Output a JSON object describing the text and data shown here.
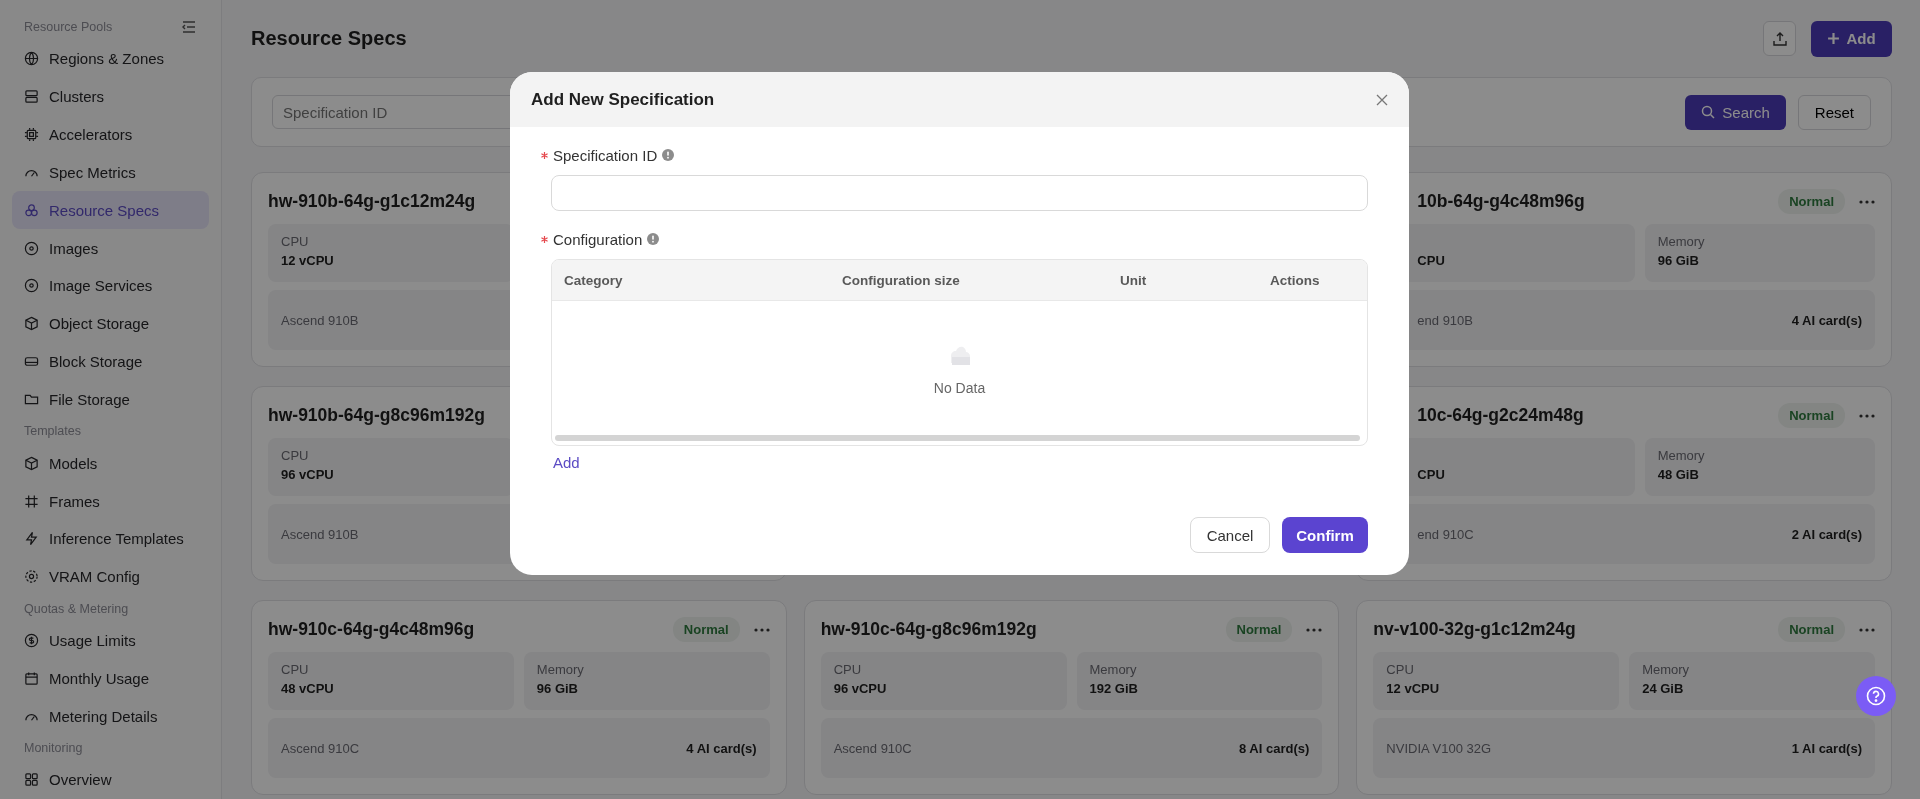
{
  "sidebar": {
    "sections": [
      {
        "label": "Resource Pools",
        "items": [
          {
            "label": "Regions & Zones",
            "selected": false
          },
          {
            "label": "Clusters",
            "selected": false
          },
          {
            "label": "Accelerators",
            "selected": false
          },
          {
            "label": "Spec Metrics",
            "selected": false
          },
          {
            "label": "Resource Specs",
            "selected": true
          },
          {
            "label": "Images",
            "selected": false
          },
          {
            "label": "Image Services",
            "selected": false
          },
          {
            "label": "Object Storage",
            "selected": false
          },
          {
            "label": "Block Storage",
            "selected": false
          },
          {
            "label": "File Storage",
            "selected": false
          }
        ]
      },
      {
        "label": "Templates",
        "items": [
          {
            "label": "Models",
            "selected": false
          },
          {
            "label": "Frames",
            "selected": false
          },
          {
            "label": "Inference Templates",
            "selected": false
          },
          {
            "label": "VRAM Config",
            "selected": false
          }
        ]
      },
      {
        "label": "Quotas & Metering",
        "items": [
          {
            "label": "Usage Limits",
            "selected": false
          },
          {
            "label": "Monthly Usage",
            "selected": false
          },
          {
            "label": "Metering Details",
            "selected": false
          }
        ]
      },
      {
        "label": "Monitoring",
        "items": [
          {
            "label": "Overview",
            "selected": false
          }
        ]
      }
    ]
  },
  "page": {
    "title": "Resource Specs",
    "add_button": "Add"
  },
  "filter": {
    "placeholder": "Specification ID",
    "search_button": "Search",
    "reset_button": "Reset"
  },
  "cards": [
    {
      "name": "hw-910b-64g-g1c12m24g",
      "cpu_label": "CPU",
      "cpu": "12 vCPU",
      "accelerator": "Ascend 910B",
      "partly_hidden": false
    },
    {
      "name": "10b-64g-g4c48m96g",
      "status": "Normal",
      "cpu": "CPU",
      "memory_label": "Memory",
      "memory": "96 GiB",
      "accelerator": "end 910B",
      "ai_cards": "4 AI card(s)",
      "partly_hidden": true
    },
    {
      "name": "hw-910b-64g-g8c96m192g",
      "cpu_label": "CPU",
      "cpu": "96 vCPU",
      "accelerator": "Ascend 910B",
      "partly_hidden": false
    },
    {
      "name": "10c-64g-g2c24m48g",
      "status": "Normal",
      "cpu": "CPU",
      "memory_label": "Memory",
      "memory": "48 GiB",
      "accelerator": "end 910C",
      "ai_cards": "2 AI card(s)",
      "partly_hidden": true
    },
    {
      "name": "hw-910c-64g-g4c48m96g",
      "status": "Normal",
      "cpu_label": "CPU",
      "cpu": "48 vCPU",
      "memory_label": "Memory",
      "memory": "96 GiB",
      "accelerator": "Ascend 910C",
      "ai_cards": "4 AI card(s)",
      "partly_hidden": false
    },
    {
      "name": "hw-910c-64g-g8c96m192g",
      "status": "Normal",
      "cpu_label": "CPU",
      "cpu": "96 vCPU",
      "memory_label": "Memory",
      "memory": "192 GiB",
      "accelerator": "Ascend 910C",
      "ai_cards": "8 AI card(s)",
      "partly_hidden": false
    },
    {
      "name": "nv-v100-32g-g1c12m24g",
      "status": "Normal",
      "cpu_label": "CPU",
      "cpu": "12 vCPU",
      "memory_label": "Memory",
      "memory": "24 GiB",
      "accelerator": "NVIDIA V100 32G",
      "ai_cards": "1 AI card(s)",
      "partly_hidden": false
    }
  ],
  "dialog": {
    "title": "Add New Specification",
    "fields": [
      {
        "label": "Specification ID",
        "required": true,
        "kind": "input"
      },
      {
        "label": "Configuration",
        "required": true,
        "kind": "table"
      }
    ],
    "table": {
      "columns": [
        "Category",
        "Configuration size",
        "Unit",
        "Actions"
      ],
      "empty_text": "No Data"
    },
    "add_link": "Add",
    "cancel_button": "Cancel",
    "confirm_button": "Confirm"
  }
}
